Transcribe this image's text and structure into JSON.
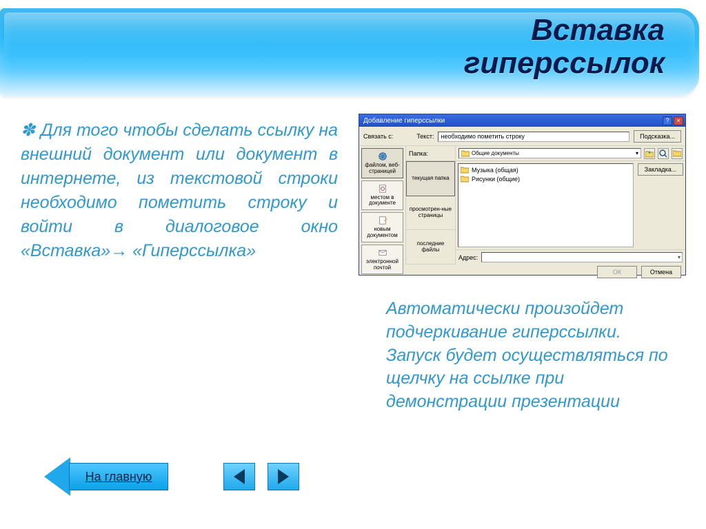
{
  "title_line1": "Вставка",
  "title_line2": "гиперссылок",
  "body_text": "Для того чтобы сделать ссылку на внешний документ или документ в интернете, из текстовой строки необходимо пометить строку и войти в диалоговое окно «Вставка»→ «Гиперссылка»",
  "right_note": "Автоматически произойдет подчеркивание гиперссылки. Запуск будет осуществляться по щелчку на ссылке при демонстрации презентации",
  "dialog": {
    "title": "Добавление гиперссылки",
    "link_with_label": "Связать с:",
    "text_label": "Текст:",
    "text_value": "необходимо пометить строку",
    "tip_button": "Подсказка...",
    "link_tabs": [
      "файлом, веб-страницей",
      "местом в документе",
      "новым документом",
      "электронной почтой"
    ],
    "folder_label": "Папка:",
    "folder_value": "Общие документы",
    "mid_buttons": [
      "текущая папка",
      "просмотрен-ные страницы",
      "последние файлы"
    ],
    "file_items": [
      "Музыка (общая)",
      "Рисунки (общие)"
    ],
    "bookmark_button": "Закладка...",
    "address_label": "Адрес:",
    "ok_button": "ОК",
    "cancel_button": "Отмена"
  },
  "nav": {
    "home": "На главную"
  }
}
